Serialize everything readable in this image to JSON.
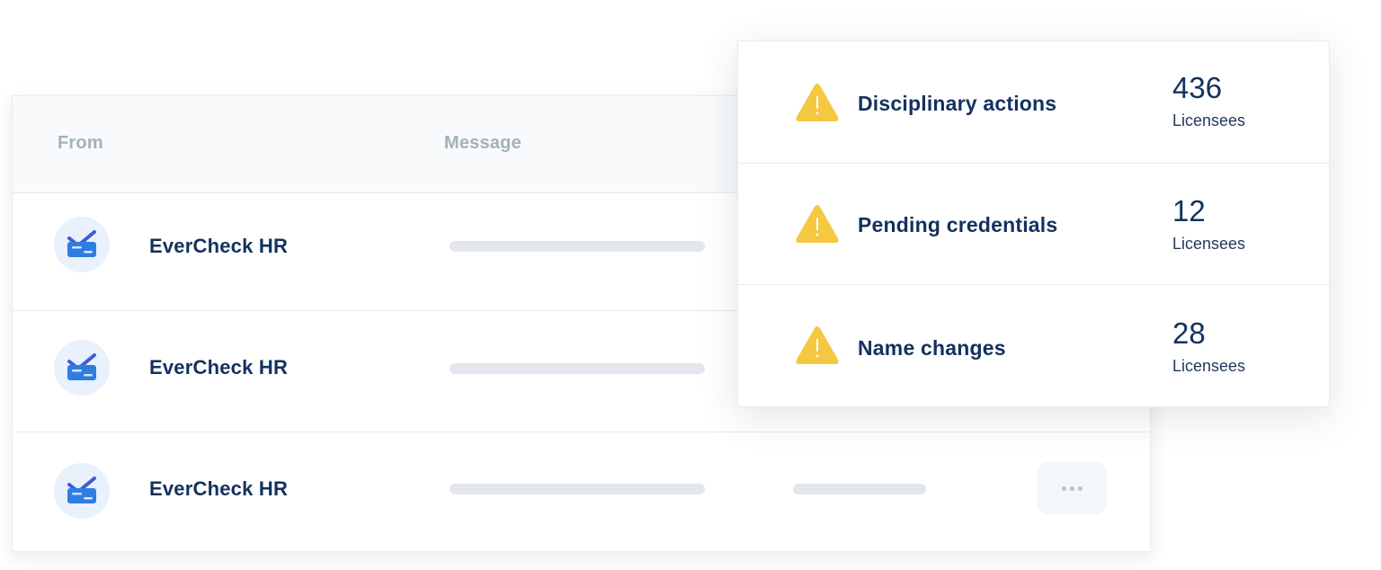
{
  "inbox": {
    "columns": {
      "from": "From",
      "message": "Message"
    },
    "rows": [
      {
        "sender": "EverCheck HR",
        "avatar_icon": "evercheck-logo-icon"
      },
      {
        "sender": "EverCheck HR",
        "avatar_icon": "evercheck-logo-icon"
      },
      {
        "sender": "EverCheck HR",
        "avatar_icon": "evercheck-logo-icon",
        "actions_icon": "more-dots-icon"
      }
    ]
  },
  "alerts": [
    {
      "label": "Disciplinary actions",
      "count": "436",
      "unit": "Licensees",
      "icon": "warning-icon"
    },
    {
      "label": "Pending credentials",
      "count": "12",
      "unit": "Licensees",
      "icon": "warning-icon"
    },
    {
      "label": "Name changes",
      "count": "28",
      "unit": "Licensees",
      "icon": "warning-icon"
    }
  ],
  "colors": {
    "navy_text": "#13315e",
    "muted_header": "#a4b1b9",
    "warning_yellow": "#f5c842",
    "avatar_bg": "#e8f1fc",
    "logo_blue": "#2f7de1"
  }
}
